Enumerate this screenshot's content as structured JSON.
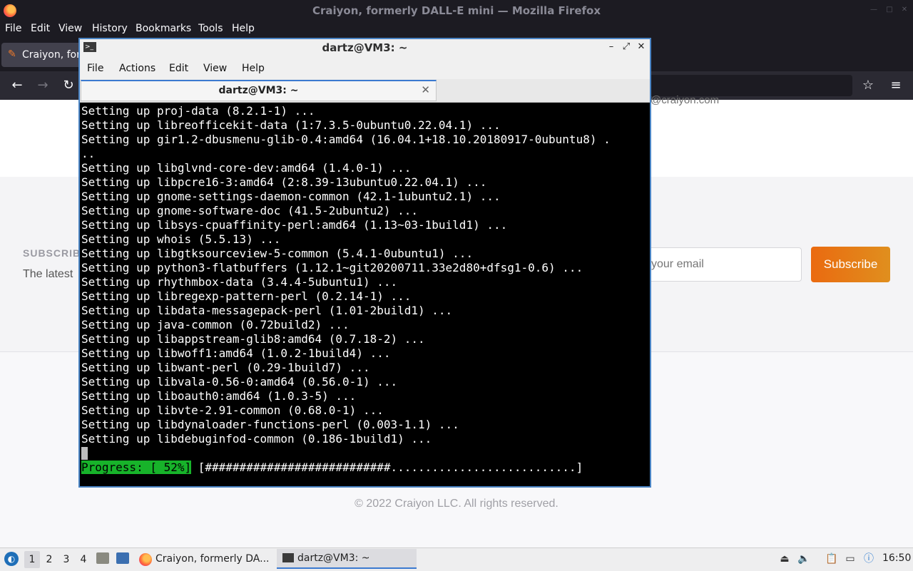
{
  "firefox": {
    "window_title": "Craiyon, formerly DALL-E mini — Mozilla Firefox",
    "menu": [
      "File",
      "Edit",
      "View",
      "History",
      "Bookmarks",
      "Tools",
      "Help"
    ],
    "tab_label": "Craiyon, for",
    "window_controls": {
      "minimize": "—",
      "maximize": "□",
      "close": "✕"
    }
  },
  "page": {
    "site_link": "@craiyon.com",
    "subscribe_heading": "SUBSCRIBE",
    "subscribe_desc": "The latest",
    "email_placeholder": "your email",
    "subscribe_button": "Subscribe",
    "copyright": "© 2022 Craiyon LLC. All rights reserved."
  },
  "terminal": {
    "title": "dartz@VM3: ~",
    "icon_glyph": ">_",
    "menu": [
      "File",
      "Actions",
      "Edit",
      "View",
      "Help"
    ],
    "tab_label": "dartz@VM3: ~",
    "tab_close": "✕",
    "lines": [
      "Setting up proj-data (8.2.1-1) ...",
      "Setting up libreofficekit-data (1:7.3.5-0ubuntu0.22.04.1) ...",
      "Setting up gir1.2-dbusmenu-glib-0.4:amd64 (16.04.1+18.10.20180917-0ubuntu8) .",
      "..",
      "Setting up libglvnd-core-dev:amd64 (1.4.0-1) ...",
      "Setting up libpcre16-3:amd64 (2:8.39-13ubuntu0.22.04.1) ...",
      "Setting up gnome-settings-daemon-common (42.1-1ubuntu2.1) ...",
      "Setting up gnome-software-doc (41.5-2ubuntu2) ...",
      "Setting up libsys-cpuaffinity-perl:amd64 (1.13~03-1build1) ...",
      "Setting up whois (5.5.13) ...",
      "Setting up libgtksourceview-5-common (5.4.1-0ubuntu1) ...",
      "Setting up python3-flatbuffers (1.12.1~git20200711.33e2d80+dfsg1-0.6) ...",
      "Setting up rhythmbox-data (3.4.4-5ubuntu1) ...",
      "Setting up libregexp-pattern-perl (0.2.14-1) ...",
      "Setting up libdata-messagepack-perl (1.01-2build1) ...",
      "Setting up java-common (0.72build2) ...",
      "Setting up libappstream-glib8:amd64 (0.7.18-2) ...",
      "Setting up libwoff1:amd64 (1.0.2-1build4) ...",
      "Setting up libwant-perl (0.29-1build7) ...",
      "Setting up libvala-0.56-0:amd64 (0.56.0-1) ...",
      "Setting up liboauth0:amd64 (1.0.3-5) ...",
      "Setting up libvte-2.91-common (0.68.0-1) ...",
      "Setting up libdynaloader-functions-perl (0.003-1.1) ...",
      "Setting up libdebuginfod-common (0.186-1build1) ..."
    ],
    "progress_label": "Progress: [ 52%]",
    "progress_bar": " [###########################...........................]",
    "progress_percent": 52
  },
  "taskbar": {
    "workspaces": [
      "1",
      "2",
      "3",
      "4"
    ],
    "active_workspace": "1",
    "tasks": [
      {
        "label": "Craiyon, formerly DA...",
        "icon": "firefox-icon"
      },
      {
        "label": "dartz@VM3: ~",
        "icon": "terminal-icon"
      }
    ],
    "clock": "16:50"
  },
  "colors": {
    "accent_blue": "#3b7ad0",
    "progress_green": "#17b32a",
    "subscribe_orange": "#ea6a10"
  }
}
